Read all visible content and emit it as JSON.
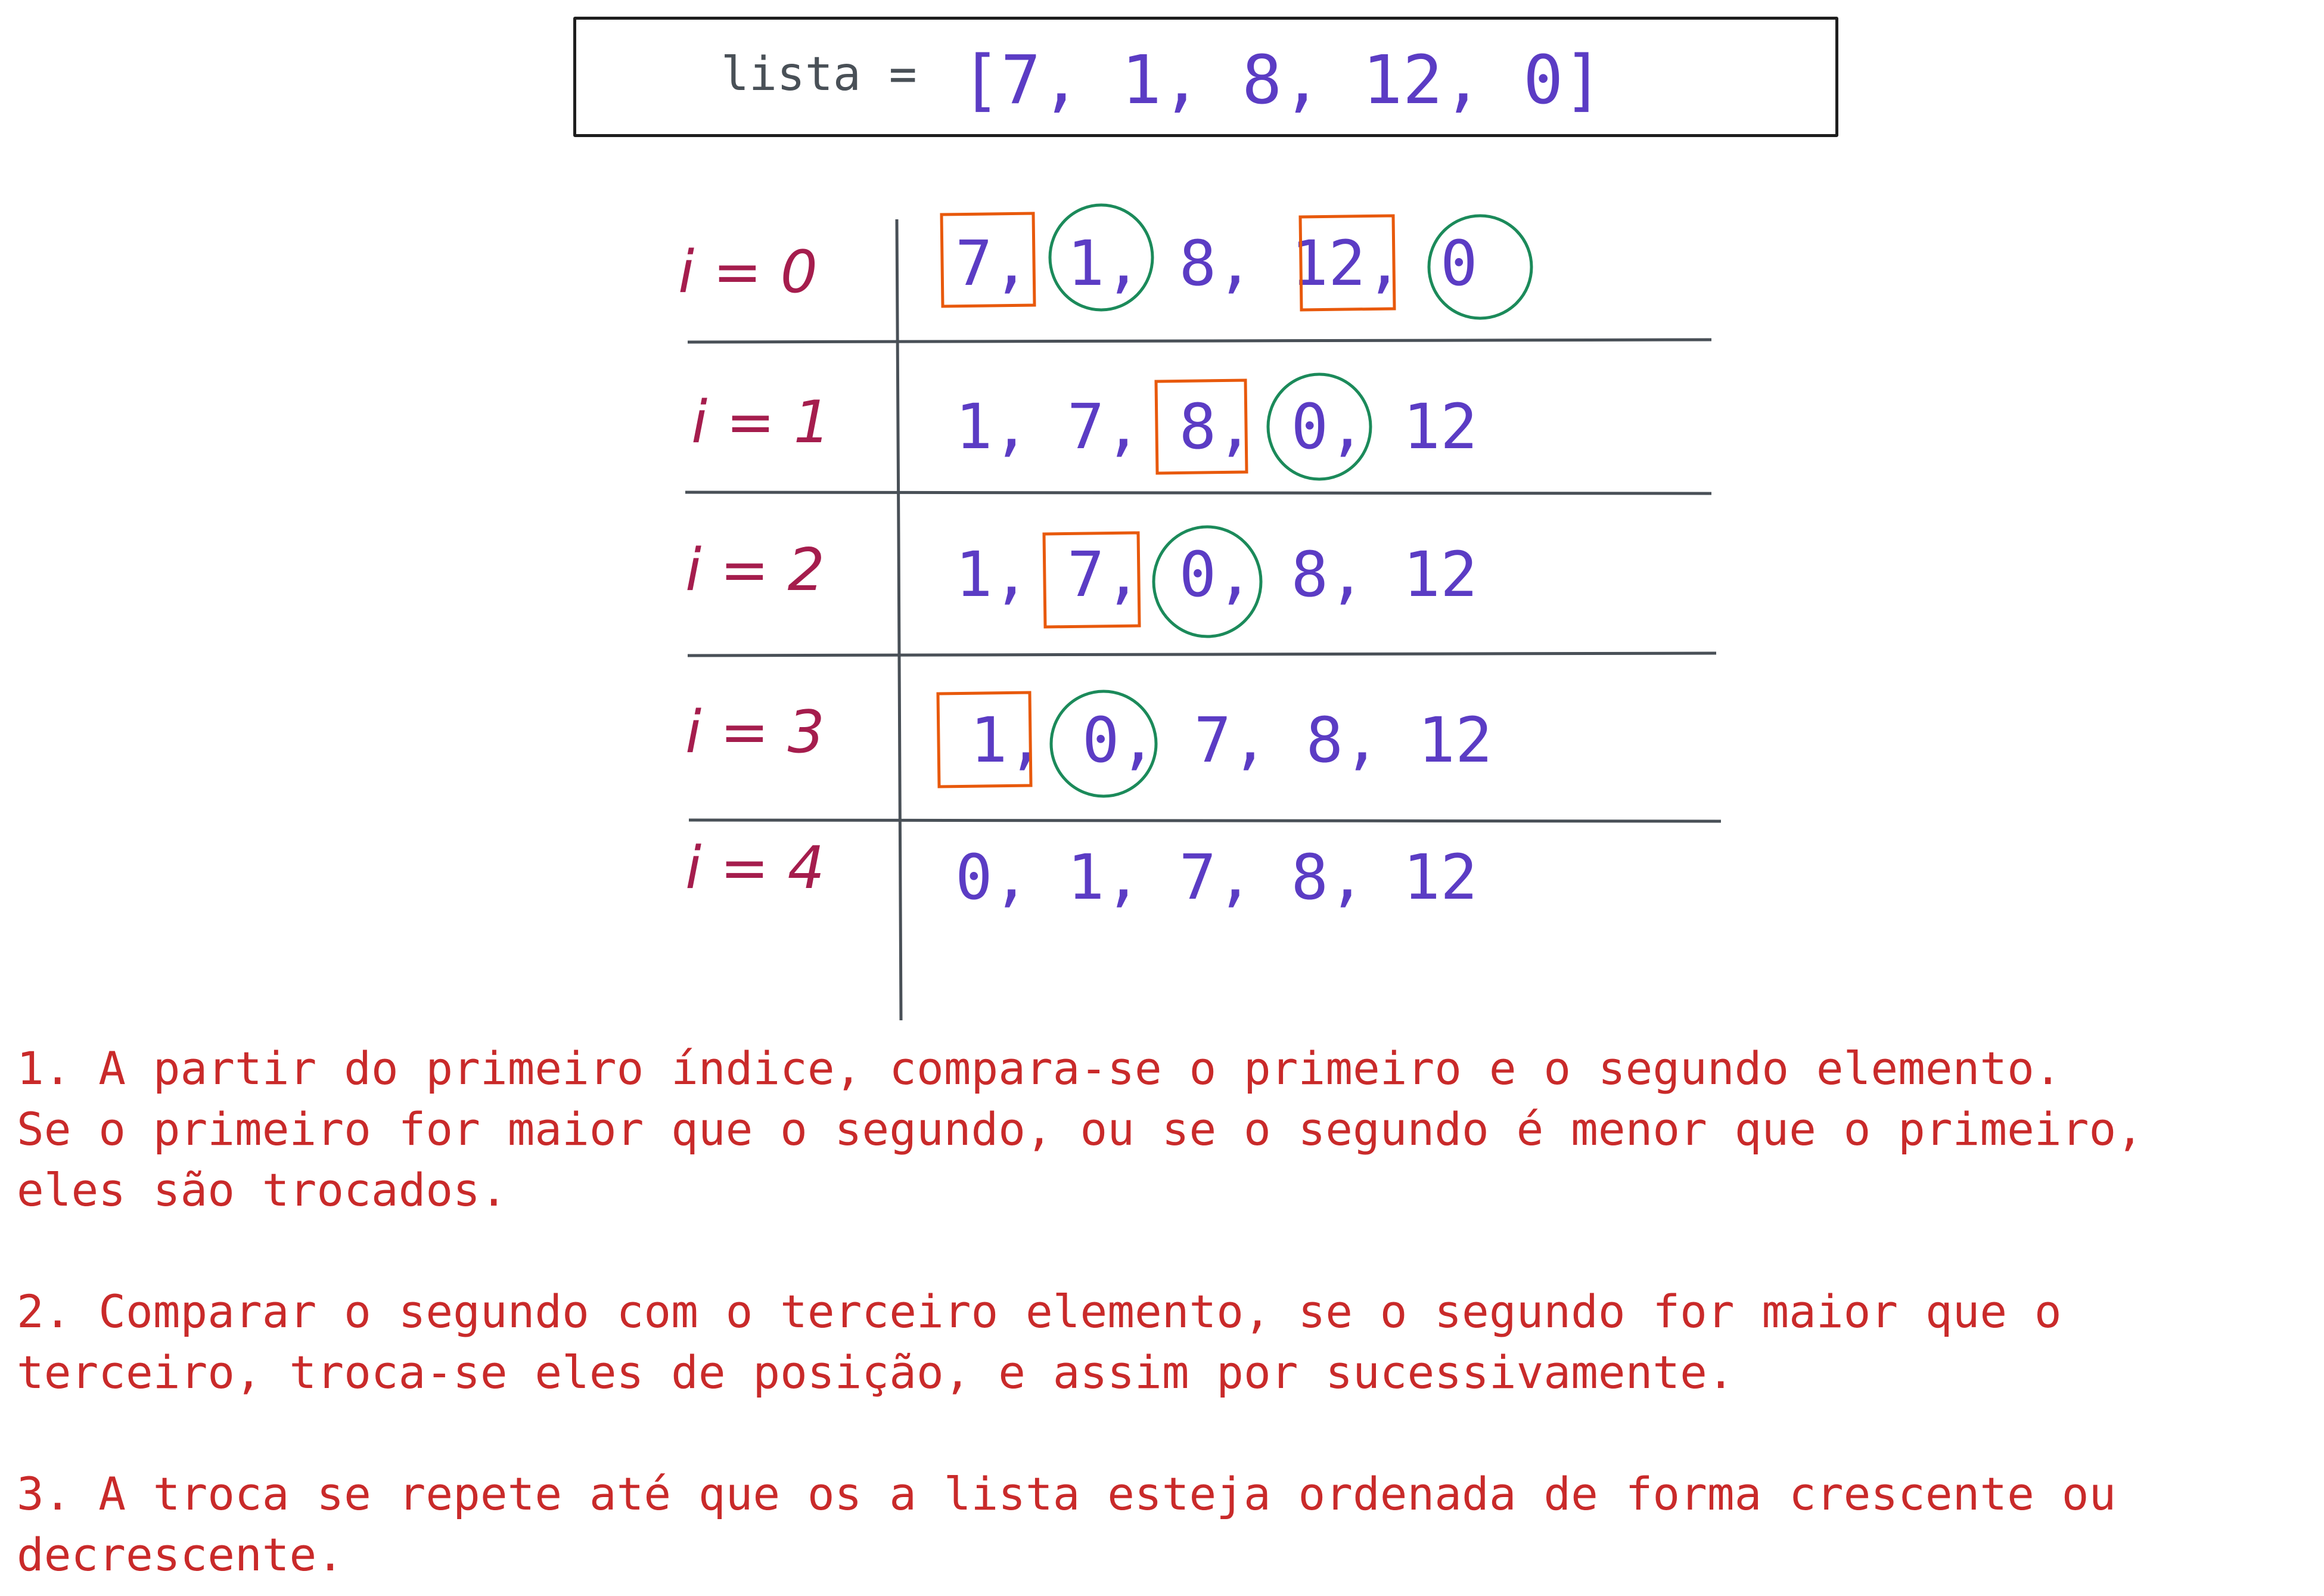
{
  "header": {
    "prefix": "lista = ",
    "list": "[7, 1, 8, 12, 0]"
  },
  "rows": [
    {
      "label": "i = 0",
      "values": "7, 1, 8, 12, 0"
    },
    {
      "label": "i = 1",
      "values": "1, 7, 8, 0, 12"
    },
    {
      "label": "i = 2",
      "values": "1, 7, 0, 8, 12"
    },
    {
      "label": "i = 3",
      "values": "1, 0, 7, 8, 12"
    },
    {
      "label": "i = 4",
      "values": "0, 1, 7, 8, 12"
    }
  ],
  "notes": [
    "1. A partir do primeiro índice, compara-se o primeiro e o segundo elemento.\nSe o primeiro for maior que o segundo, ou se o segundo é menor que o primeiro,\neles são trocados.",
    "2. Comparar o segundo com o terceiro elemento, se o segundo for maior que o\nterceiro, troca-se eles de posição, e assim por sucessivamente.",
    "3. A troca se repete até que os a lista esteja ordenada de forma crescente ou\ndecrescente."
  ],
  "colors": {
    "numbers": "#5b3cc4",
    "labels": "#a51d4d",
    "square_highlight": "#e8590c",
    "circle_highlight": "#1b8a5a",
    "notes": "#c92a2a",
    "lines": "#495057"
  }
}
